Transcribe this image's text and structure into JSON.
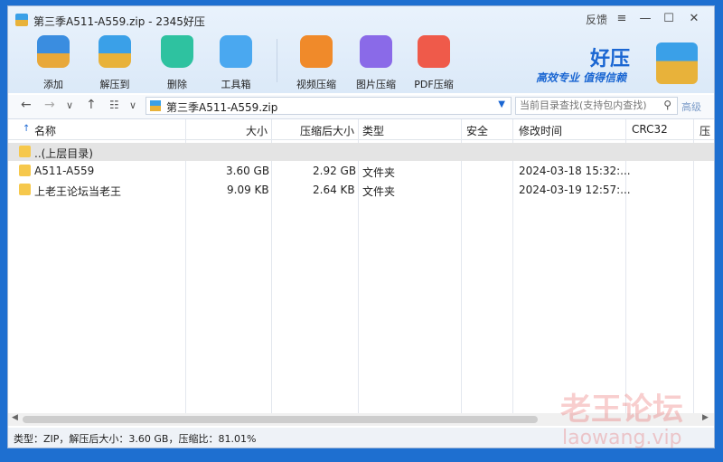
{
  "window": {
    "title": "第三季A511-A559.zip - 2345好压",
    "feedback": "反馈",
    "menu_icon": "≡",
    "min_icon": "—",
    "max_icon": "☐",
    "close_icon": "✕"
  },
  "toolbar": [
    {
      "label": "添加",
      "icon": "add-icon",
      "color": "#3a8de0"
    },
    {
      "label": "解压到",
      "icon": "extract-icon",
      "color": "#3aa0e8"
    },
    {
      "label": "删除",
      "icon": "recycle-icon",
      "color": "#2ec2a0"
    },
    {
      "label": "工具箱",
      "icon": "toolbox-icon",
      "color": "#4aa8f0"
    },
    {
      "label": "视频压缩",
      "icon": "video-icon",
      "color": "#f08a2a"
    },
    {
      "label": "图片压缩",
      "icon": "image-icon",
      "color": "#8a6ae8"
    },
    {
      "label": "PDF压缩",
      "icon": "pdf-icon",
      "color": "#ef5a4a"
    }
  ],
  "brand": {
    "name": "好压",
    "slogan": "高效专业 值得信赖"
  },
  "nav": {
    "path": "第三季A511-A559.zip",
    "search_placeholder": "当前目录查找(支持包内查找)",
    "advanced": "高级",
    "back": "←",
    "forward": "→",
    "dropdown": "∨",
    "up": "↑",
    "view": "☷"
  },
  "columns": [
    {
      "label": "名称",
      "sort": "↑"
    },
    {
      "label": "大小"
    },
    {
      "label": "压缩后大小"
    },
    {
      "label": "类型"
    },
    {
      "label": "安全"
    },
    {
      "label": "修改时间"
    },
    {
      "label": "CRC32"
    },
    {
      "label": "压"
    }
  ],
  "rows": [
    {
      "name": "..(上层目录)",
      "size": "",
      "packed": "",
      "type": "",
      "security": "",
      "modified": "",
      "crc": ""
    },
    {
      "name": "A511-A559",
      "size": "3.60 GB",
      "packed": "2.92 GB",
      "type": "文件夹",
      "security": "",
      "modified": "2024-03-18 15:32:...",
      "crc": ""
    },
    {
      "name": "上老王论坛当老王",
      "size": "9.09 KB",
      "packed": "2.64 KB",
      "type": "文件夹",
      "security": "",
      "modified": "2024-03-19 12:57:...",
      "crc": ""
    }
  ],
  "status": "类型：ZIP，解压后大小：3.60 GB，压缩比：81.01%",
  "watermark": {
    "line1": "老王论坛",
    "line2": "laowang.vip"
  }
}
